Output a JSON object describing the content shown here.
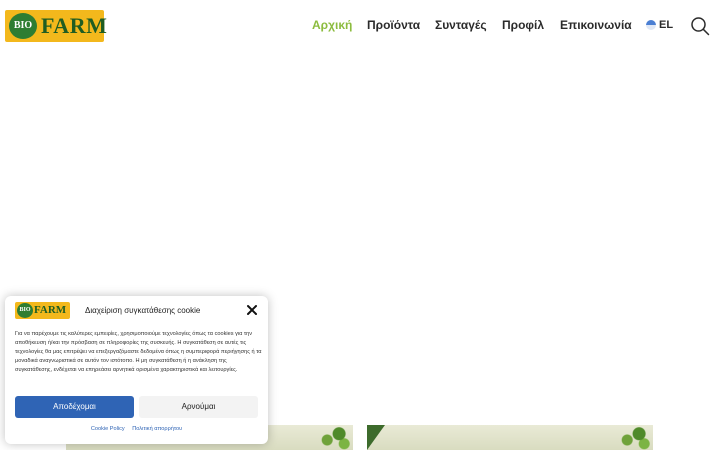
{
  "header": {
    "logo": {
      "left": "BIO",
      "right": "FARM"
    },
    "nav": [
      {
        "label": "Αρχική",
        "active": true
      },
      {
        "label": "Προϊόντα",
        "active": false
      },
      {
        "label": "Συνταγές",
        "active": false
      },
      {
        "label": "Προφίλ",
        "active": false
      },
      {
        "label": "Επικοινωνία",
        "active": false
      }
    ],
    "language": "EL",
    "search_icon": "search-icon"
  },
  "colors": {
    "accent_green": "#8cbc3f",
    "logo_yellow": "#f3b81c",
    "logo_green": "#1f5d22",
    "accept_blue": "#2f64b5"
  },
  "cookie_banner": {
    "logo": {
      "left": "BIO",
      "right": "FARM"
    },
    "title": "Διαχείριση συγκατάθεσης cookie",
    "text": "Για να παρέχουμε τις καλύτερες εμπειρίες, χρησιμοποιούμε τεχνολογίες όπως τα cookies για την αποθήκευση ή/και την πρόσβαση σε πληροφορίες της συσκευής. Η συγκατάθεση σε αυτές τις τεχνολογίες θα μας επιτρέψει να επεξεργαζόμαστε δεδομένα όπως η συμπεριφορά περιήγησης ή τα μοναδικά αναγνωριστικά σε αυτόν τον ιστότοπο. Η μη συγκατάθεση ή η ανάκληση της συγκατάθεσης, ενδέχεται να επηρεάσει αρνητικά ορισμένα χαρακτηριστικά και λειτουργίες.",
    "accept_label": "Αποδέχομαι",
    "deny_label": "Αρνούμαι",
    "links": [
      "Cookie Policy",
      "Πολιτική απορρήτου"
    ]
  }
}
